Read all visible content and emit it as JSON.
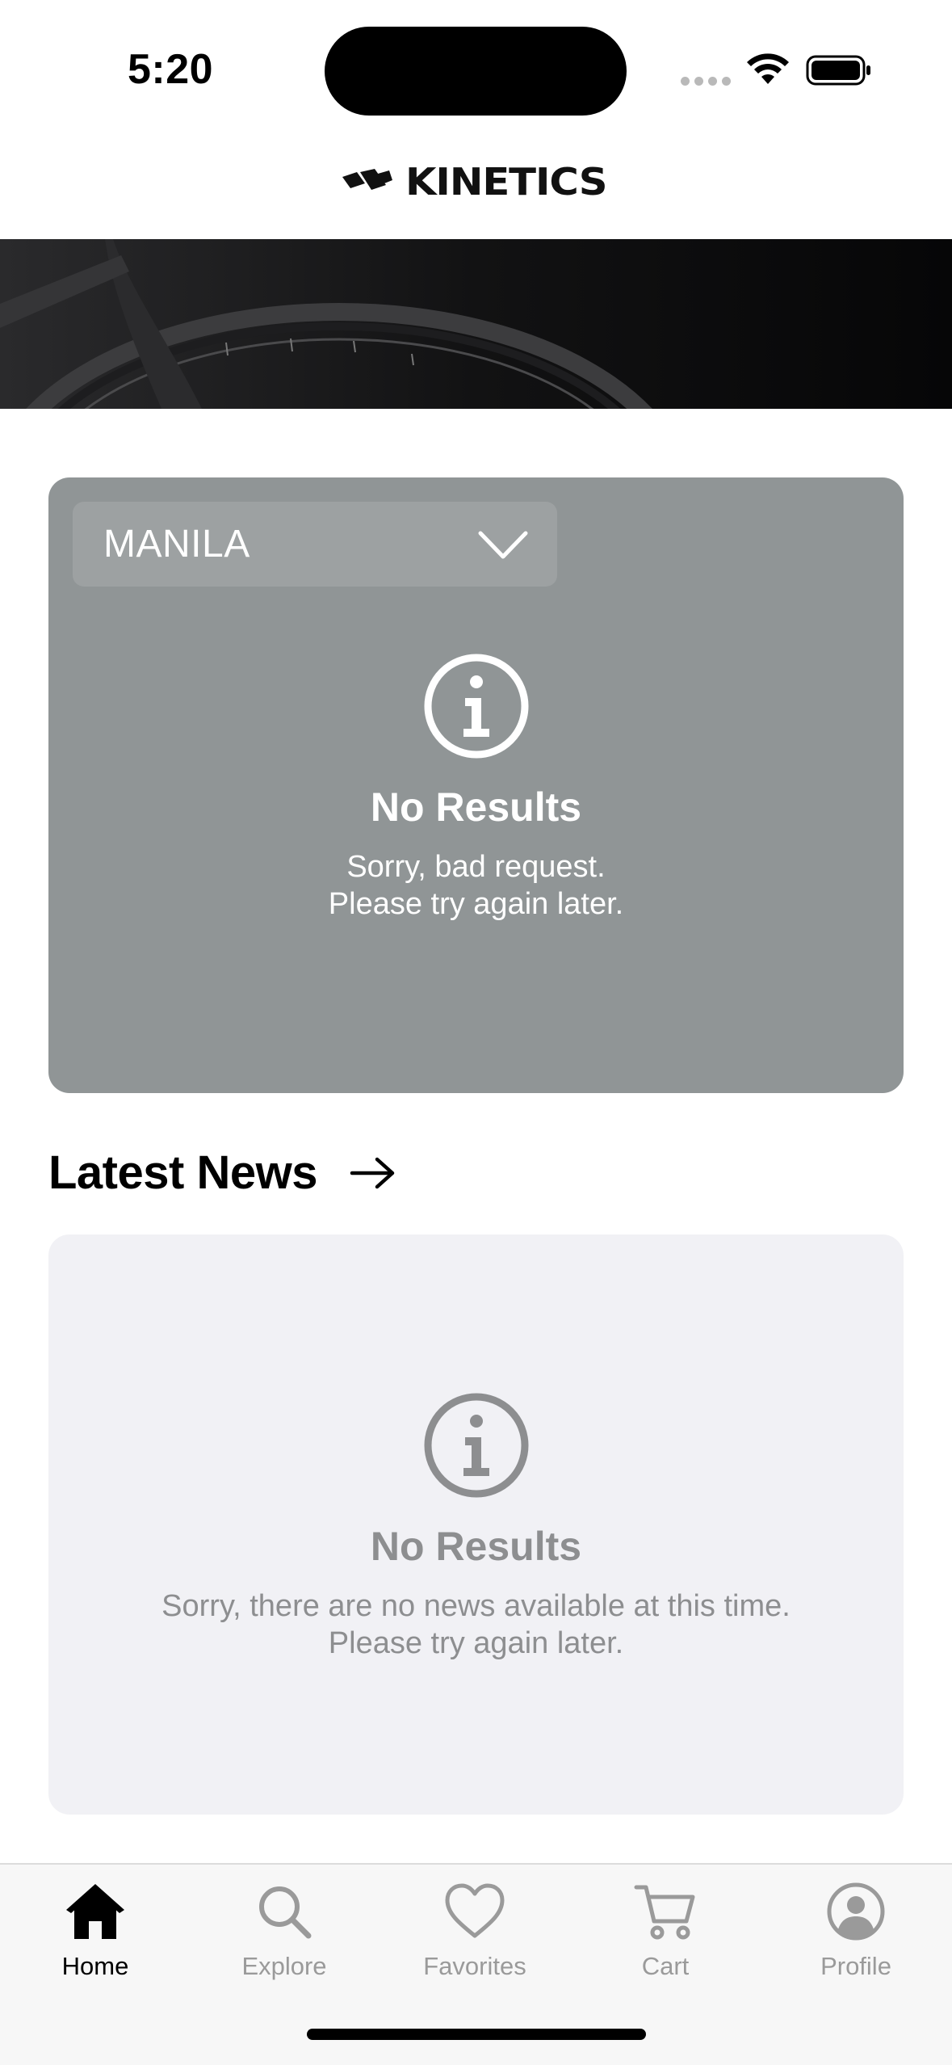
{
  "status_bar": {
    "time": "5:20"
  },
  "header": {
    "brand": "KINETICS"
  },
  "store_card": {
    "location_dropdown": {
      "selected": "MANILA"
    },
    "empty_state": {
      "title": "No Results",
      "message_line1": "Sorry, bad request.",
      "message_line2": "Please try again later."
    }
  },
  "news_section": {
    "title": "Latest News",
    "empty_state": {
      "title": "No Results",
      "message_line1": "Sorry, there are no news available at this time.",
      "message_line2": "Please try again later."
    }
  },
  "tab_bar": {
    "tabs": [
      {
        "label": "Home",
        "icon": "home-icon",
        "active": true
      },
      {
        "label": "Explore",
        "icon": "search-icon",
        "active": false
      },
      {
        "label": "Favorites",
        "icon": "heart-icon",
        "active": false
      },
      {
        "label": "Cart",
        "icon": "cart-icon",
        "active": false
      },
      {
        "label": "Profile",
        "icon": "profile-icon",
        "active": false
      }
    ]
  },
  "colors": {
    "store_card_bg": "#909596",
    "news_card_bg": "#f1f1f5",
    "inactive_tab": "#9a9a9a",
    "active_tab": "#000000"
  }
}
